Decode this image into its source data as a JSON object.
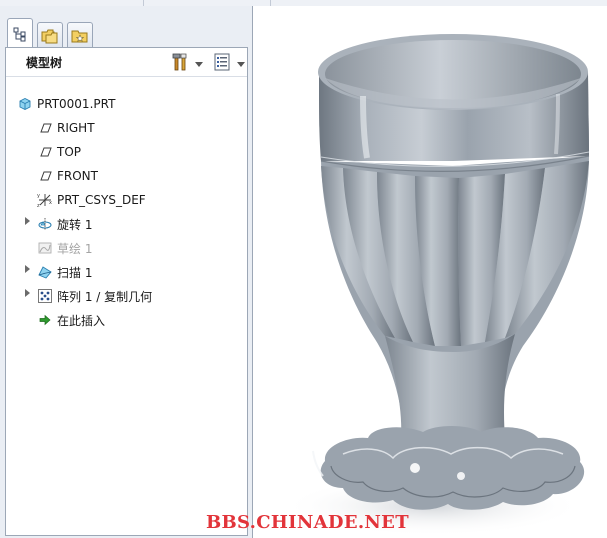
{
  "panel": {
    "tabs": [
      {
        "name": "model-tree",
        "icon": "model-tree-icon",
        "active": true
      },
      {
        "name": "folder-browser",
        "icon": "folder-browser-icon",
        "active": false
      },
      {
        "name": "favorites",
        "icon": "favorites-icon",
        "active": false
      }
    ],
    "tree_title": "模型树",
    "header_icons": [
      "tools-icon",
      "chevron-down-icon",
      "tree-settings-icon",
      "chevron-down-icon"
    ]
  },
  "tree": {
    "root": {
      "label": "PRT0001.PRT",
      "icon": "part-icon"
    },
    "items": [
      {
        "label": "RIGHT",
        "icon": "datum-plane-icon",
        "expandable": false,
        "disabled": false
      },
      {
        "label": "TOP",
        "icon": "datum-plane-icon",
        "expandable": false,
        "disabled": false
      },
      {
        "label": "FRONT",
        "icon": "datum-plane-icon",
        "expandable": false,
        "disabled": false
      },
      {
        "label": "PRT_CSYS_DEF",
        "icon": "coordinate-system-icon",
        "expandable": false,
        "disabled": false
      },
      {
        "label": "旋转 1",
        "icon": "revolve-icon",
        "expandable": true,
        "disabled": false
      },
      {
        "label": "草绘 1",
        "icon": "sketch-icon",
        "expandable": false,
        "disabled": true
      },
      {
        "label": "扫描 1",
        "icon": "sweep-icon",
        "expandable": true,
        "disabled": false
      },
      {
        "label": "阵列 1 / 复制几何",
        "icon": "pattern-icon",
        "expandable": true,
        "disabled": false
      },
      {
        "label": "在此插入",
        "icon": "insert-here-arrow-icon",
        "expandable": false,
        "disabled": false
      }
    ]
  },
  "viewport": {
    "model": "goblet-3d-model",
    "watermark": "BBS.CHINADE.NET",
    "colors": {
      "model": "#9aa3ad",
      "highlight": "#eef2f6",
      "shadow": "#5f6872",
      "watermark": "#e2343a"
    }
  }
}
